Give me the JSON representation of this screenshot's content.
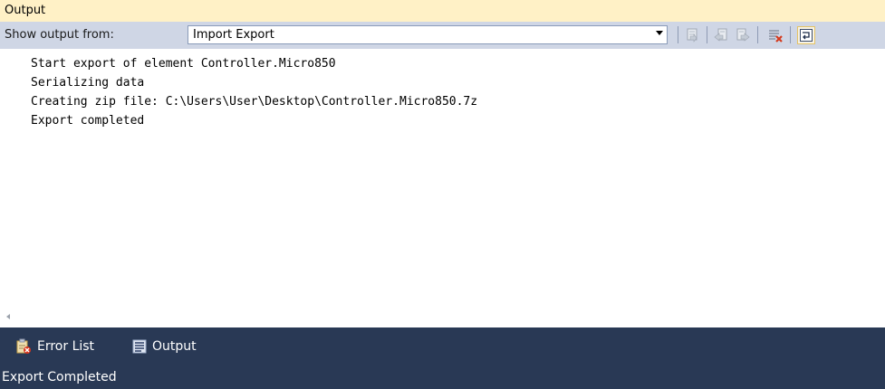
{
  "panel": {
    "title": "Output"
  },
  "toolbar": {
    "show_label": "Show output from:",
    "source_value": "Import Export",
    "buttons": [
      {
        "icon": "go-to-source-icon"
      },
      {
        "icon": "previous-message-icon"
      },
      {
        "icon": "next-message-icon"
      },
      {
        "icon": "clear-all-icon"
      },
      {
        "icon": "word-wrap-icon",
        "active": true
      }
    ]
  },
  "output": {
    "lines": [
      "Start export of element Controller.Micro850",
      "Serializing data",
      "Creating zip file: C:\\Users\\User\\Desktop\\Controller.Micro850.7z",
      "Export completed"
    ]
  },
  "tabs": [
    {
      "label": "Error List",
      "icon": "error-list-icon"
    },
    {
      "label": "Output",
      "icon": "output-icon"
    }
  ],
  "status": {
    "text": "Export Completed"
  },
  "colors": {
    "title_bar": "#fff1c6",
    "toolbar": "#cfd6e5",
    "shell": "#293955"
  }
}
